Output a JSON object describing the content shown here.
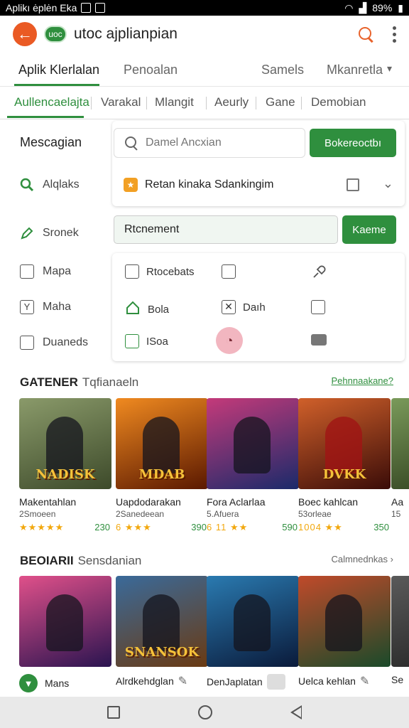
{
  "statusbar": {
    "left_text": "Aplikı ėplėn Eka",
    "battery": "89%"
  },
  "appbar": {
    "logo_text": "←",
    "logo2_text": "uoc",
    "title": "utoc ajplianpian"
  },
  "tabs_primary": [
    {
      "label": "Aplik Klerlalan",
      "active": true
    },
    {
      "label": "Penoalan",
      "active": false
    },
    {
      "label": "Samels",
      "active": false
    },
    {
      "label": "Mkanretla",
      "active": false
    }
  ],
  "tabs_secondary": [
    {
      "label": "Aullencaelajta",
      "active": true
    },
    {
      "label": "Varakal",
      "active": false
    },
    {
      "label": "Mlangit",
      "active": false
    },
    {
      "label": "Aeurly",
      "active": false
    },
    {
      "label": "Gane",
      "active": false
    },
    {
      "label": "Demobian",
      "active": false
    }
  ],
  "left_panel": {
    "title": "Mescagian",
    "items": [
      {
        "label": "Alqlaks",
        "icon": "search-icon"
      },
      {
        "label": "Sronek",
        "icon": "pencil-icon"
      },
      {
        "label": "Mapa",
        "icon": "map-icon"
      },
      {
        "label": "Maha",
        "icon": "y-box-icon"
      },
      {
        "label": "Duaneds",
        "icon": "box-icon"
      }
    ]
  },
  "search": {
    "placeholder": "Damel Ancxian",
    "button": "Bokereoctbı"
  },
  "filter_row": {
    "badge": "★",
    "text": "Retan kinaka Sdankingim"
  },
  "input2": {
    "value": "Rtcnement",
    "button": "Kaeme"
  },
  "grid_items": [
    {
      "label": "Rtocebats",
      "icon": "photo-icon"
    },
    {
      "label": "",
      "icon": "frame-icon"
    },
    {
      "label": "",
      "icon": "brush-icon"
    },
    {
      "label": "Bola",
      "icon": "house-icon"
    },
    {
      "label": "Daıh",
      "icon": "cross-box-icon"
    },
    {
      "label": "",
      "icon": "layers-icon"
    },
    {
      "label": "ISoa",
      "icon": "screen-icon"
    },
    {
      "label": "",
      "icon": "face-icon"
    },
    {
      "label": "",
      "icon": "keyboard-icon"
    }
  ],
  "section1": {
    "title": "GATENER",
    "subtitle": "Tqfianaeln",
    "link": "Pehnnaakane?",
    "games": [
      {
        "thumb": "NADISK",
        "name": "Makentahlan",
        "sub": "2Smoeen",
        "stars": "★★★★★",
        "num": "230",
        "bg": "#5d6a3e"
      },
      {
        "thumb": "MDAB",
        "name": "Uapdodarakan",
        "sub": "2Sanedeean",
        "stars": "6 ★★★",
        "num": "390",
        "bg": "#b8460f"
      },
      {
        "thumb": "",
        "name": "Fora Aclarlaa",
        "sub": "5.Afuera",
        "stars": "6 11 ★★",
        "num": "590",
        "bg": "#3a2c6e"
      },
      {
        "thumb": "DVKK",
        "name": "Boec kahlcan",
        "sub": "53orleae",
        "stars": "1004 ★★",
        "num": "350",
        "bg": "#6a1a14"
      },
      {
        "thumb": "",
        "name": "Aa",
        "sub": "15",
        "stars": "",
        "num": "",
        "bg": "#4a6a3a"
      }
    ]
  },
  "section2": {
    "title": "BEOIARII",
    "subtitle": "Sensdanian",
    "link": "Calmnednkas",
    "games": [
      {
        "thumb": "",
        "name": "Mans",
        "bg": "#6a2a4e"
      },
      {
        "thumb": "SNANSOK",
        "name": "Alrdkehdglan",
        "bg": "#6a3a22"
      },
      {
        "thumb": "",
        "name": "DenJaplatan",
        "bg": "#1e3d5a"
      },
      {
        "thumb": "",
        "name": "Uelca kehlan",
        "bg": "#2a4a2e"
      },
      {
        "thumb": "",
        "name": "Se",
        "bg": "#4a4a4a"
      }
    ]
  },
  "colors": {
    "accent": "#2f8f3e",
    "brand": "#ea5a24"
  }
}
